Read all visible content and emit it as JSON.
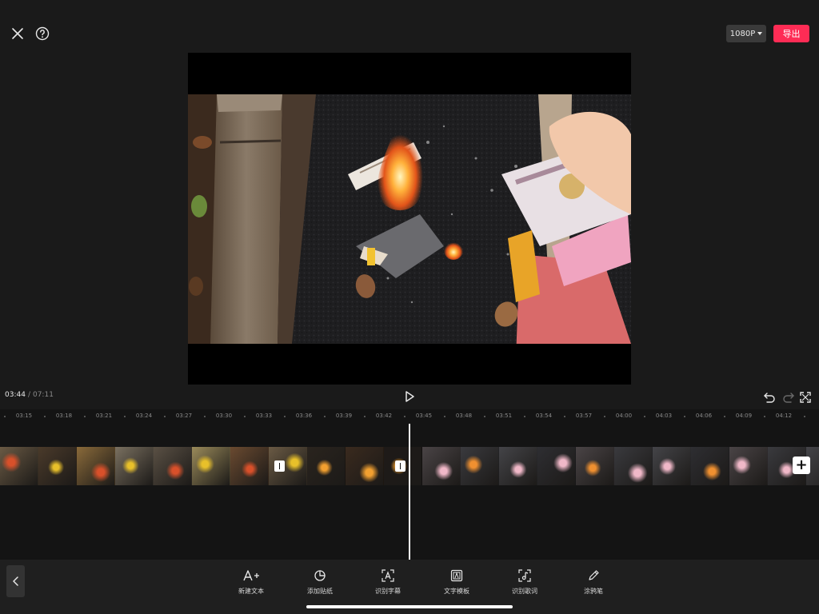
{
  "topbar": {
    "resolution_label": "1080P",
    "export_label": "导出"
  },
  "player": {
    "current_time": "03:44",
    "separator": "/",
    "total_time": "07:11"
  },
  "timeline": {
    "ticks": [
      "03:15",
      "03:18",
      "03:21",
      "03:24",
      "03:27",
      "03:30",
      "03:33",
      "03:36",
      "03:39",
      "03:42",
      "03:45",
      "03:48",
      "03:51",
      "03:54",
      "03:57",
      "04:00",
      "04:03",
      "04:06",
      "04:09",
      "04:12"
    ]
  },
  "toolbar": {
    "items": [
      {
        "label": "新建文本",
        "icon": "add-text-icon"
      },
      {
        "label": "添加贴纸",
        "icon": "sticker-icon"
      },
      {
        "label": "识别字幕",
        "icon": "recognize-captions-icon"
      },
      {
        "label": "文字模板",
        "icon": "text-template-icon"
      },
      {
        "label": "识别歌词",
        "icon": "recognize-lyrics-icon"
      },
      {
        "label": "涂鸦笔",
        "icon": "doodle-pen-icon"
      }
    ]
  },
  "colors": {
    "accent": "#fe2c55",
    "background": "#1a1a1a",
    "timeline_bg": "#141414"
  }
}
